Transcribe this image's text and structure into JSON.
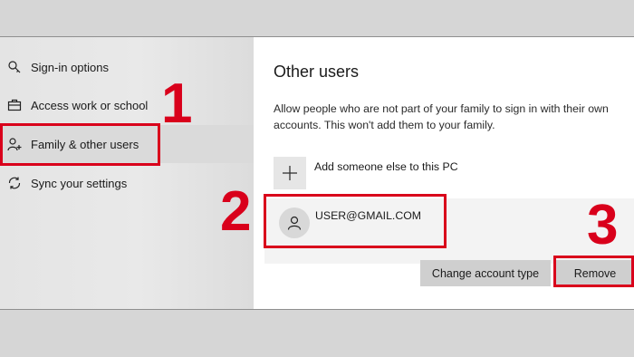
{
  "sidebar": {
    "items": [
      {
        "label": "Sign-in options",
        "icon": "key-icon"
      },
      {
        "label": "Access work or school",
        "icon": "briefcase-icon"
      },
      {
        "label": "Family & other users",
        "icon": "person-add-icon",
        "selected": true
      },
      {
        "label": "Sync your settings",
        "icon": "sync-icon"
      }
    ]
  },
  "main": {
    "heading": "Other users",
    "description": "Allow people who are not part of your family to sign in with their own accounts. This won't add them to your family.",
    "add_user_label": "Add someone else to this PC",
    "user": {
      "email": "USER@GMAIL.COM"
    },
    "buttons": {
      "change_type": "Change account type",
      "remove": "Remove"
    }
  },
  "annotations": {
    "step1": "1",
    "step2": "2",
    "step3": "3",
    "color": "#d9001b"
  }
}
